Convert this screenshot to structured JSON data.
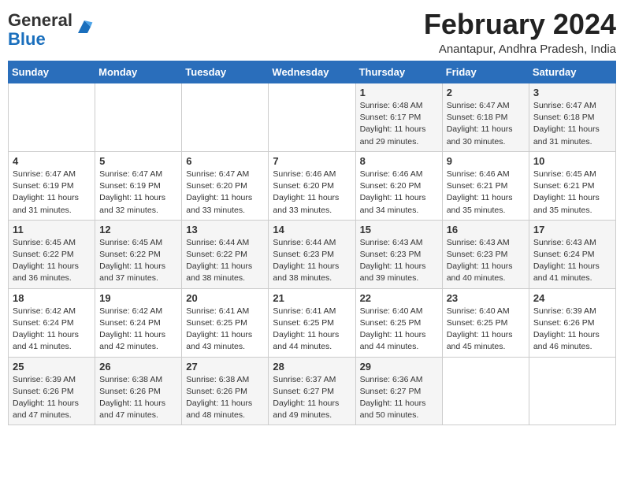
{
  "header": {
    "logo_line1": "General",
    "logo_line2": "Blue",
    "month": "February 2024",
    "location": "Anantapur, Andhra Pradesh, India"
  },
  "weekdays": [
    "Sunday",
    "Monday",
    "Tuesday",
    "Wednesday",
    "Thursday",
    "Friday",
    "Saturday"
  ],
  "weeks": [
    [
      {
        "day": "",
        "info": ""
      },
      {
        "day": "",
        "info": ""
      },
      {
        "day": "",
        "info": ""
      },
      {
        "day": "",
        "info": ""
      },
      {
        "day": "1",
        "info": "Sunrise: 6:48 AM\nSunset: 6:17 PM\nDaylight: 11 hours and 29 minutes."
      },
      {
        "day": "2",
        "info": "Sunrise: 6:47 AM\nSunset: 6:18 PM\nDaylight: 11 hours and 30 minutes."
      },
      {
        "day": "3",
        "info": "Sunrise: 6:47 AM\nSunset: 6:18 PM\nDaylight: 11 hours and 31 minutes."
      }
    ],
    [
      {
        "day": "4",
        "info": "Sunrise: 6:47 AM\nSunset: 6:19 PM\nDaylight: 11 hours and 31 minutes."
      },
      {
        "day": "5",
        "info": "Sunrise: 6:47 AM\nSunset: 6:19 PM\nDaylight: 11 hours and 32 minutes."
      },
      {
        "day": "6",
        "info": "Sunrise: 6:47 AM\nSunset: 6:20 PM\nDaylight: 11 hours and 33 minutes."
      },
      {
        "day": "7",
        "info": "Sunrise: 6:46 AM\nSunset: 6:20 PM\nDaylight: 11 hours and 33 minutes."
      },
      {
        "day": "8",
        "info": "Sunrise: 6:46 AM\nSunset: 6:20 PM\nDaylight: 11 hours and 34 minutes."
      },
      {
        "day": "9",
        "info": "Sunrise: 6:46 AM\nSunset: 6:21 PM\nDaylight: 11 hours and 35 minutes."
      },
      {
        "day": "10",
        "info": "Sunrise: 6:45 AM\nSunset: 6:21 PM\nDaylight: 11 hours and 35 minutes."
      }
    ],
    [
      {
        "day": "11",
        "info": "Sunrise: 6:45 AM\nSunset: 6:22 PM\nDaylight: 11 hours and 36 minutes."
      },
      {
        "day": "12",
        "info": "Sunrise: 6:45 AM\nSunset: 6:22 PM\nDaylight: 11 hours and 37 minutes."
      },
      {
        "day": "13",
        "info": "Sunrise: 6:44 AM\nSunset: 6:22 PM\nDaylight: 11 hours and 38 minutes."
      },
      {
        "day": "14",
        "info": "Sunrise: 6:44 AM\nSunset: 6:23 PM\nDaylight: 11 hours and 38 minutes."
      },
      {
        "day": "15",
        "info": "Sunrise: 6:43 AM\nSunset: 6:23 PM\nDaylight: 11 hours and 39 minutes."
      },
      {
        "day": "16",
        "info": "Sunrise: 6:43 AM\nSunset: 6:23 PM\nDaylight: 11 hours and 40 minutes."
      },
      {
        "day": "17",
        "info": "Sunrise: 6:43 AM\nSunset: 6:24 PM\nDaylight: 11 hours and 41 minutes."
      }
    ],
    [
      {
        "day": "18",
        "info": "Sunrise: 6:42 AM\nSunset: 6:24 PM\nDaylight: 11 hours and 41 minutes."
      },
      {
        "day": "19",
        "info": "Sunrise: 6:42 AM\nSunset: 6:24 PM\nDaylight: 11 hours and 42 minutes."
      },
      {
        "day": "20",
        "info": "Sunrise: 6:41 AM\nSunset: 6:25 PM\nDaylight: 11 hours and 43 minutes."
      },
      {
        "day": "21",
        "info": "Sunrise: 6:41 AM\nSunset: 6:25 PM\nDaylight: 11 hours and 44 minutes."
      },
      {
        "day": "22",
        "info": "Sunrise: 6:40 AM\nSunset: 6:25 PM\nDaylight: 11 hours and 44 minutes."
      },
      {
        "day": "23",
        "info": "Sunrise: 6:40 AM\nSunset: 6:25 PM\nDaylight: 11 hours and 45 minutes."
      },
      {
        "day": "24",
        "info": "Sunrise: 6:39 AM\nSunset: 6:26 PM\nDaylight: 11 hours and 46 minutes."
      }
    ],
    [
      {
        "day": "25",
        "info": "Sunrise: 6:39 AM\nSunset: 6:26 PM\nDaylight: 11 hours and 47 minutes."
      },
      {
        "day": "26",
        "info": "Sunrise: 6:38 AM\nSunset: 6:26 PM\nDaylight: 11 hours and 47 minutes."
      },
      {
        "day": "27",
        "info": "Sunrise: 6:38 AM\nSunset: 6:26 PM\nDaylight: 11 hours and 48 minutes."
      },
      {
        "day": "28",
        "info": "Sunrise: 6:37 AM\nSunset: 6:27 PM\nDaylight: 11 hours and 49 minutes."
      },
      {
        "day": "29",
        "info": "Sunrise: 6:36 AM\nSunset: 6:27 PM\nDaylight: 11 hours and 50 minutes."
      },
      {
        "day": "",
        "info": ""
      },
      {
        "day": "",
        "info": ""
      }
    ]
  ]
}
